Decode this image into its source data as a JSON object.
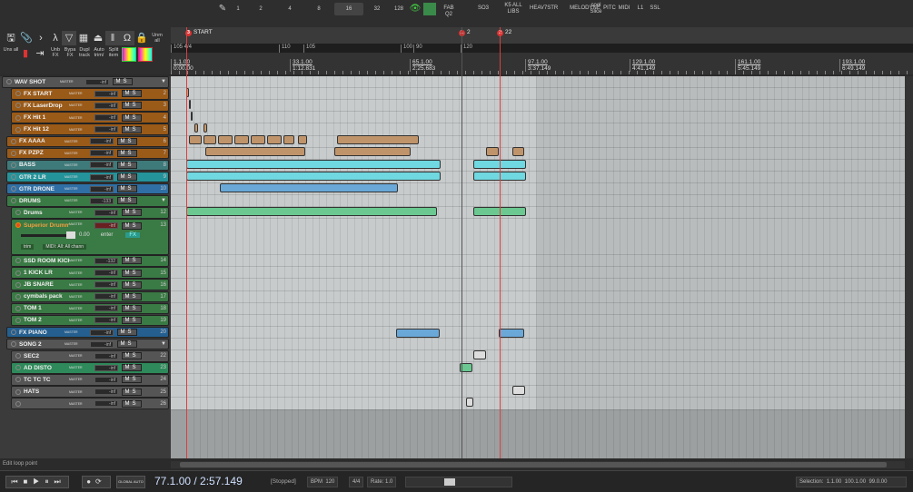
{
  "toolbar_top": {
    "grid_buttons": [
      "1",
      "2",
      "4",
      "8",
      "16",
      "32",
      "128"
    ],
    "selected_grid": "16",
    "actions": [
      "FAB Q2",
      "SO3",
      "K5 ALL LIBS",
      "HEAV7STR",
      "MELODYNE",
      "cool Slice",
      "PITC",
      "MIDI",
      "L1",
      "SSL"
    ]
  },
  "tools": {
    "row2": [
      "Uns all",
      "Unb FX",
      "Bypa FX",
      "Dupl track",
      "Auto trim/",
      "Split item"
    ],
    "unmute_all": "Unm all"
  },
  "markers": [
    {
      "id": "3",
      "label": "START"
    },
    {
      "id": "1",
      "label": "2"
    },
    {
      "id": "2",
      "label": "22"
    }
  ],
  "tempo_markers": [
    "105 4/4",
    "110",
    "105",
    "100",
    "90",
    "120"
  ],
  "ruler": [
    {
      "bar": "1.1.00",
      "time": "0:00.00"
    },
    {
      "bar": "33.1.00",
      "time": "1:12.831"
    },
    {
      "bar": "65.1.00",
      "time": "2:25.683"
    },
    {
      "bar": "97.1.00",
      "time": "3:37.149"
    },
    {
      "bar": "129.1.00",
      "time": "4:41.149"
    },
    {
      "bar": "161.1.00",
      "time": "5:45.149"
    },
    {
      "bar": "193.1.00",
      "time": "6:49.149"
    }
  ],
  "track_io_label": "MASTER",
  "tracks": [
    {
      "num": "1",
      "name": "WAV SHOT",
      "vol": "-inf",
      "color": "#555555",
      "indent": 0,
      "folder": true
    },
    {
      "num": "2",
      "name": "FX START",
      "vol": "-inf",
      "color": "#9a5a18",
      "indent": 2
    },
    {
      "num": "3",
      "name": "FX LaserDrop",
      "vol": "-inf",
      "color": "#9a5a18",
      "indent": 2
    },
    {
      "num": "4",
      "name": "FX Hit 1",
      "vol": "-inf",
      "color": "#9a5a18",
      "indent": 2
    },
    {
      "num": "5",
      "name": "FX Hit 12",
      "vol": "-inf",
      "color": "#9a5a18",
      "indent": 2
    },
    {
      "num": "6",
      "name": "FX AAAA",
      "vol": "-inf",
      "color": "#9a5a18",
      "indent": 1
    },
    {
      "num": "7",
      "name": "FX PZPZ",
      "vol": "-inf",
      "color": "#9a5a18",
      "indent": 1
    },
    {
      "num": "8",
      "name": "BASS",
      "vol": "-inf",
      "color": "#3f7a7a",
      "indent": 1
    },
    {
      "num": "9",
      "name": "GTR 2 LR",
      "vol": "-inf",
      "color": "#25939a",
      "indent": 1
    },
    {
      "num": "10",
      "name": "GTR DRONE",
      "vol": "-inf",
      "color": "#2f6fa5",
      "indent": 1
    },
    {
      "num": "11",
      "name": "DRUMS",
      "vol": "-133",
      "color": "#3a7a45",
      "indent": 1,
      "folder": true
    },
    {
      "num": "12",
      "name": "Drums",
      "vol": "-inf",
      "color": "#3a7a45",
      "indent": 2
    },
    {
      "num": "13",
      "name": "Superior Drumm...3",
      "vol": "-inf",
      "color": "#3a7a45",
      "indent": 2,
      "tall": true,
      "fader": "0.00",
      "enter": "enter",
      "fx": "FX",
      "midi": "MIDI: All: All chann",
      "trim": "trim"
    },
    {
      "num": "14",
      "name": "SSD ROOM KICK",
      "vol": "-132",
      "color": "#3a7a45",
      "indent": 2
    },
    {
      "num": "15",
      "name": "1 KICK LR",
      "vol": "-inf",
      "color": "#3a7a45",
      "indent": 2
    },
    {
      "num": "16",
      "name": "JB SNARE",
      "vol": "-inf",
      "color": "#3a7a45",
      "indent": 2
    },
    {
      "num": "17",
      "name": "cymbals pack",
      "vol": "-inf",
      "color": "#3a7a45",
      "indent": 2
    },
    {
      "num": "18",
      "name": "TOM 1",
      "vol": "-inf",
      "color": "#3a7a45",
      "indent": 2
    },
    {
      "num": "19",
      "name": "TOM 2",
      "vol": "-inf",
      "color": "#3a7a45",
      "indent": 2
    },
    {
      "num": "20",
      "name": "FX PIANO",
      "vol": "-inf",
      "color": "#245f90",
      "indent": 1
    },
    {
      "num": "21",
      "name": "SONG 2",
      "vol": "-inf",
      "color": "#555555",
      "indent": 1,
      "folder": true
    },
    {
      "num": "22",
      "name": "SEC2",
      "vol": "-inf",
      "color": "#555555",
      "indent": 2
    },
    {
      "num": "23",
      "name": "AD DISTO",
      "vol": "-inf",
      "color": "#2e8a5a",
      "indent": 2
    },
    {
      "num": "24",
      "name": "TC TC TC",
      "vol": "-inf",
      "color": "#555555",
      "indent": 2
    },
    {
      "num": "25",
      "name": "HATS",
      "vol": "-inf",
      "color": "#555555",
      "indent": 2
    },
    {
      "num": "26",
      "name": "",
      "vol": "-inf",
      "color": "#555555",
      "indent": 2
    }
  ],
  "status_text": "Edit loop point",
  "transport": {
    "position": "77.1.00 / 2:57.149",
    "state": "[Stopped]",
    "bpm_label": "BPM",
    "bpm": "120",
    "time_sig": "4/4",
    "rate_label": "Rate:",
    "rate": "1.0",
    "global_auto": "GLOBAL AUTO",
    "selection_label": "Selection:",
    "selection_start": "1.1.00",
    "selection_end": "100.1.00",
    "selection_length": "99.0.00"
  }
}
